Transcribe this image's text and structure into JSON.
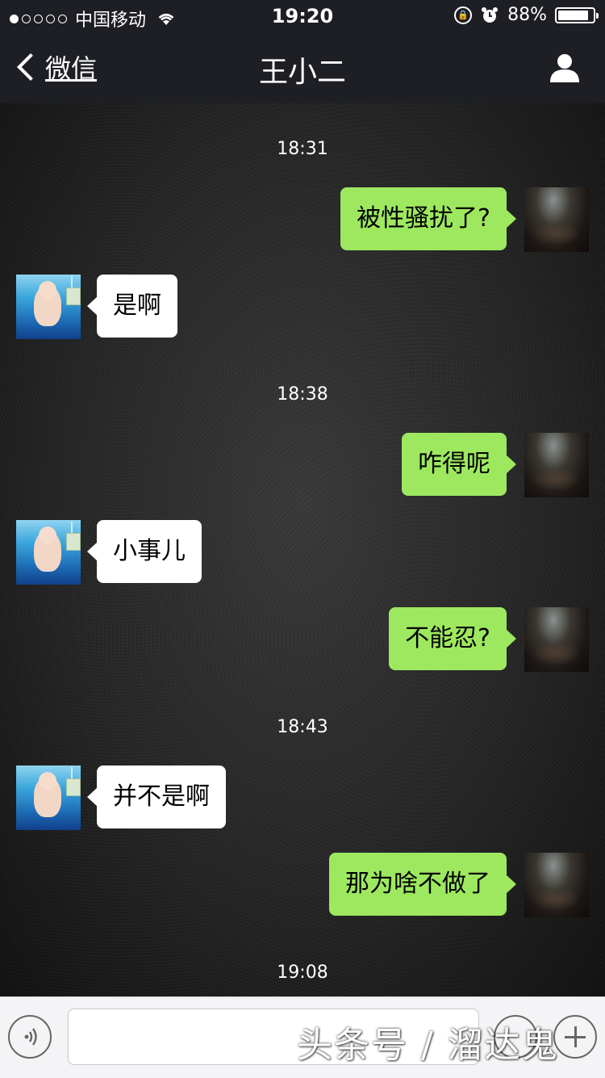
{
  "status_bar": {
    "carrier": "中国移动",
    "time": "19:20",
    "battery_percent": "88%",
    "battery_level": 0.88,
    "signal_bars_filled": 1,
    "signal_bars_total": 5,
    "icons": [
      "wifi-icon",
      "orientation-lock-icon",
      "alarm-icon",
      "battery-icon"
    ]
  },
  "nav": {
    "back_label": "微信",
    "title": "王小二",
    "right_icon": "person-icon"
  },
  "chat": {
    "timestamps": [
      "18:31",
      "18:38",
      "18:43",
      "19:08"
    ],
    "messages": [
      {
        "from": "me",
        "text": "被性骚扰了?"
      },
      {
        "from": "them",
        "text": "是啊"
      },
      {
        "from": "me",
        "text": "咋得呢"
      },
      {
        "from": "them",
        "text": "小事儿"
      },
      {
        "from": "me",
        "text": "不能忍?"
      },
      {
        "from": "them",
        "text": "并不是啊"
      },
      {
        "from": "me",
        "text": "那为啥不做了"
      }
    ],
    "colors": {
      "my_bubble": "#9ee85f",
      "their_bubble": "#ffffff"
    }
  },
  "input_bar": {
    "voice_icon": "voice-icon",
    "emoji_icon": "emoji-icon",
    "plus_icon": "plus-icon",
    "text_value": ""
  },
  "watermark": "头条号 / 溜达鬼"
}
